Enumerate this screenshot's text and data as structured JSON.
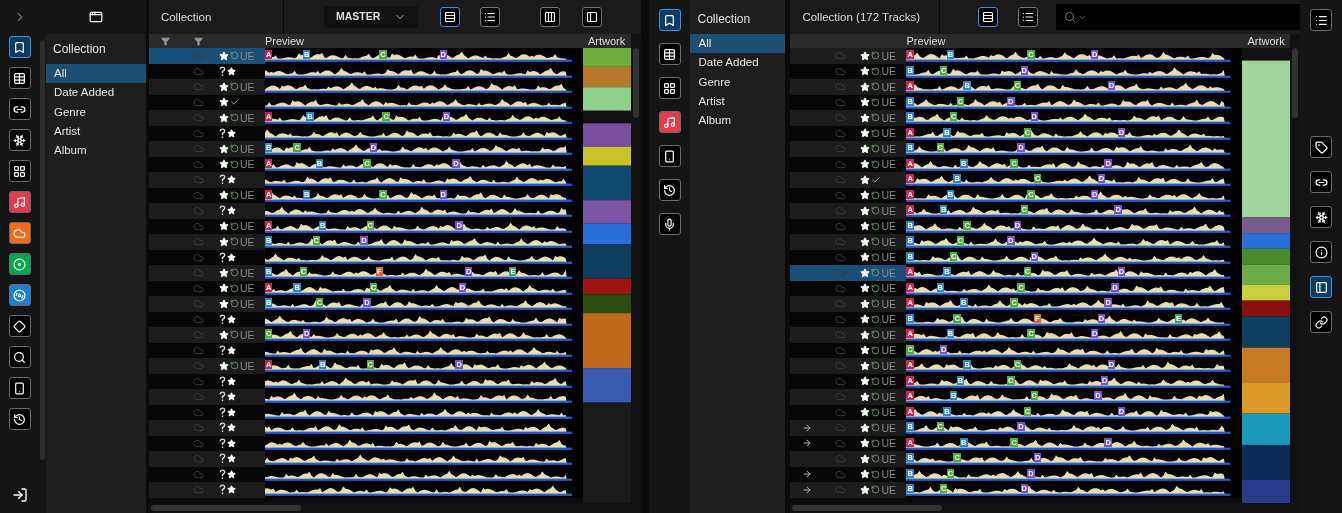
{
  "left_sidebar": {
    "icons": [
      {
        "kind": "bookmark",
        "selected": true
      },
      {
        "kind": "table",
        "selected": false
      },
      {
        "kind": "connector",
        "selected": false
      },
      {
        "kind": "burst",
        "selected": false
      },
      {
        "kind": "grid",
        "selected": false
      },
      {
        "kind": "music",
        "selected": false
      },
      {
        "kind": "soundcloud",
        "selected": false
      },
      {
        "kind": "beatport",
        "selected": false
      },
      {
        "kind": "beatsource",
        "selected": false
      },
      {
        "kind": "tidal",
        "selected": false
      },
      {
        "kind": "search",
        "selected": false
      },
      {
        "kind": "device",
        "selected": false
      },
      {
        "kind": "history",
        "selected": false
      }
    ]
  },
  "left_tree": {
    "title": "Collection",
    "items": [
      {
        "label": "All",
        "selected": true
      },
      {
        "label": "Date Added",
        "selected": false
      },
      {
        "label": "Genre",
        "selected": false
      },
      {
        "label": "Artist",
        "selected": false
      },
      {
        "label": "Album",
        "selected": false
      }
    ]
  },
  "left_deck": {
    "title": "Collection",
    "deck": "MASTER",
    "view_buttons": [
      {
        "kind": "detail",
        "selected": true
      },
      {
        "kind": "list",
        "selected": false
      },
      {
        "kind": "columns",
        "selected": false
      },
      {
        "kind": "panel",
        "selected": false
      }
    ],
    "columns": [
      "Preview",
      "Artwork"
    ],
    "tracks": [
      {
        "kind": "analyzed",
        "status": "UE",
        "selected": true,
        "cues": [
          {
            "label": "A",
            "color": "#d3224f"
          },
          {
            "label": "B",
            "color": "#2d86c9"
          },
          {
            "label": "C",
            "color": "#4fae3a"
          },
          {
            "label": "D",
            "color": "#7a4fd6"
          }
        ]
      },
      {
        "kind": "unanalyzed",
        "selected": false
      },
      {
        "kind": "analyzed",
        "status": "UE",
        "selected": false
      },
      {
        "kind": "checked",
        "selected": false
      },
      {
        "kind": "analyzed",
        "status": "UE",
        "selected": false,
        "cues": [
          {
            "label": "A",
            "color": "#d3224f"
          },
          {
            "label": "B",
            "color": "#2d86c9"
          },
          {
            "label": "C",
            "color": "#4fae3a"
          },
          {
            "label": "D",
            "color": "#7a4fd6"
          }
        ]
      },
      {
        "kind": "unanalyzed",
        "selected": false
      },
      {
        "kind": "analyzed",
        "status": "UE",
        "selected": false,
        "cues": [
          {
            "label": "B",
            "color": "#2d86c9"
          },
          {
            "label": "C",
            "color": "#4fae3a"
          },
          {
            "label": "D",
            "color": "#7a4fd6"
          }
        ]
      },
      {
        "kind": "analyzed",
        "status": "UE",
        "selected": false,
        "cues": [
          {
            "label": "A",
            "color": "#d3224f"
          },
          {
            "label": "B",
            "color": "#2d86c9"
          },
          {
            "label": "C",
            "color": "#4fae3a"
          },
          {
            "label": "D",
            "color": "#7a4fd6"
          }
        ]
      },
      {
        "kind": "unanalyzed",
        "selected": false
      },
      {
        "kind": "analyzed",
        "status": "UE",
        "selected": false,
        "cues": [
          {
            "label": "A",
            "color": "#d3224f"
          },
          {
            "label": "B",
            "color": "#2d86c9"
          },
          {
            "label": "C",
            "color": "#4fae3a"
          },
          {
            "label": "D",
            "color": "#7a4fd6"
          }
        ]
      },
      {
        "kind": "unanalyzed",
        "selected": false
      },
      {
        "kind": "analyzed",
        "status": "UE",
        "selected": false,
        "cues": [
          {
            "label": "A",
            "color": "#d3224f"
          },
          {
            "label": "B",
            "color": "#2d86c9"
          },
          {
            "label": "C",
            "color": "#4fae3a"
          },
          {
            "label": "D",
            "color": "#7a4fd6"
          }
        ]
      },
      {
        "kind": "analyzed",
        "status": "UE",
        "selected": false,
        "cues": [
          {
            "label": "B",
            "color": "#2d86c9"
          },
          {
            "label": "C",
            "color": "#4fae3a"
          },
          {
            "label": "D",
            "color": "#7a4fd6"
          }
        ]
      },
      {
        "kind": "unanalyzed",
        "selected": false
      },
      {
        "kind": "analyzed",
        "status": "UE",
        "selected": false,
        "cues": [
          {
            "label": "B",
            "color": "#2d86c9"
          },
          {
            "label": "C",
            "color": "#4fae3a"
          },
          {
            "label": "F",
            "color": "#e0652b"
          },
          {
            "label": "D",
            "color": "#7a4fd6"
          },
          {
            "label": "E",
            "color": "#38a86b"
          }
        ]
      },
      {
        "kind": "analyzed",
        "status": "UE",
        "selected": false,
        "cues": [
          {
            "label": "A",
            "color": "#d3224f"
          },
          {
            "label": "B",
            "color": "#2d86c9"
          },
          {
            "label": "C",
            "color": "#4fae3a"
          },
          {
            "label": "D",
            "color": "#7a4fd6"
          }
        ]
      },
      {
        "kind": "analyzed",
        "status": "UE",
        "selected": false,
        "cues": [
          {
            "label": "B",
            "color": "#2d86c9"
          },
          {
            "label": "C",
            "color": "#4fae3a"
          },
          {
            "label": "D",
            "color": "#7a4fd6"
          }
        ]
      },
      {
        "kind": "unanalyzed",
        "selected": false
      },
      {
        "kind": "analyzed",
        "status": "UE",
        "selected": false,
        "cues": [
          {
            "label": "C",
            "color": "#4fae3a"
          },
          {
            "label": "D",
            "color": "#7a4fd6"
          }
        ]
      },
      {
        "kind": "unanalyzed",
        "selected": false
      },
      {
        "kind": "analyzed",
        "status": "UE",
        "selected": false,
        "cues": [
          {
            "label": "A",
            "color": "#d3224f"
          },
          {
            "label": "B",
            "color": "#2d86c9"
          },
          {
            "label": "C",
            "color": "#4fae3a"
          },
          {
            "label": "D",
            "color": "#7a4fd6"
          }
        ]
      },
      {
        "kind": "unanalyzed",
        "selected": false
      },
      {
        "kind": "unanalyzed",
        "selected": false
      },
      {
        "kind": "unanalyzed",
        "selected": false
      },
      {
        "kind": "unanalyzed",
        "selected": false
      },
      {
        "kind": "unanalyzed",
        "selected": false
      },
      {
        "kind": "unanalyzed",
        "selected": false
      },
      {
        "kind": "unanalyzed",
        "selected": false
      },
      {
        "kind": "unanalyzed",
        "selected": false
      }
    ]
  },
  "middle_sidebar": {
    "icons": [
      {
        "kind": "bookmark",
        "selected": true
      },
      {
        "kind": "table",
        "selected": false
      },
      {
        "kind": "grid",
        "selected": false
      },
      {
        "kind": "music",
        "selected": false
      },
      {
        "kind": "device",
        "selected": false
      },
      {
        "kind": "history",
        "selected": false
      },
      {
        "kind": "mic",
        "selected": false
      }
    ]
  },
  "right_tree": {
    "title": "Collection",
    "items": [
      {
        "label": "All",
        "selected": true
      },
      {
        "label": "Date Added",
        "selected": false
      },
      {
        "label": "Genre",
        "selected": false
      },
      {
        "label": "Artist",
        "selected": false
      },
      {
        "label": "Album",
        "selected": false
      }
    ]
  },
  "right_deck": {
    "title": "Collection (172 Tracks)",
    "view_buttons": [
      {
        "kind": "detail",
        "selected": true
      },
      {
        "kind": "list",
        "selected": false
      }
    ],
    "columns": [
      "Preview",
      "Artwork"
    ],
    "tracks": [
      {
        "kind": "analyzed",
        "status": "UE",
        "selected": false,
        "arrow": false,
        "cues": [
          {
            "label": "A",
            "color": "#d3224f"
          },
          {
            "label": "B",
            "color": "#2d86c9"
          },
          {
            "label": "C",
            "color": "#4fae3a"
          },
          {
            "label": "D",
            "color": "#7a4fd6"
          }
        ]
      },
      {
        "kind": "analyzed",
        "status": "UE",
        "selected": false,
        "arrow": false,
        "cues": [
          {
            "label": "B",
            "color": "#2d86c9"
          },
          {
            "label": "C",
            "color": "#4fae3a"
          },
          {
            "label": "D",
            "color": "#7a4fd6"
          }
        ]
      },
      {
        "kind": "analyzed",
        "status": "UE",
        "selected": false,
        "arrow": false,
        "cues": [
          {
            "label": "A",
            "color": "#d3224f"
          },
          {
            "label": "B",
            "color": "#2d86c9"
          },
          {
            "label": "C",
            "color": "#4fae3a"
          },
          {
            "label": "D",
            "color": "#7a4fd6"
          }
        ]
      },
      {
        "kind": "analyzed",
        "status": "UE",
        "selected": false,
        "arrow": false,
        "cues": [
          {
            "label": "B",
            "color": "#2d86c9"
          },
          {
            "label": "C",
            "color": "#4fae3a"
          },
          {
            "label": "D",
            "color": "#7a4fd6"
          }
        ]
      },
      {
        "kind": "analyzed",
        "status": "UE",
        "selected": false,
        "arrow": false,
        "cues": [
          {
            "label": "B",
            "color": "#2d86c9"
          },
          {
            "label": "C",
            "color": "#4fae3a"
          },
          {
            "label": "D",
            "color": "#7a4fd6"
          }
        ]
      },
      {
        "kind": "analyzed",
        "status": "UE",
        "selected": false,
        "arrow": false,
        "cues": [
          {
            "label": "A",
            "color": "#d3224f"
          },
          {
            "label": "B",
            "color": "#2d86c9"
          },
          {
            "label": "C",
            "color": "#4fae3a"
          },
          {
            "label": "D",
            "color": "#7a4fd6"
          }
        ]
      },
      {
        "kind": "analyzed",
        "status": "UE",
        "selected": false,
        "arrow": false,
        "cues": [
          {
            "label": "B",
            "color": "#2d86c9"
          },
          {
            "label": "C",
            "color": "#4fae3a"
          },
          {
            "label": "D",
            "color": "#7a4fd6"
          }
        ]
      },
      {
        "kind": "analyzed",
        "status": "UE",
        "selected": false,
        "arrow": false,
        "cues": [
          {
            "label": "A",
            "color": "#d3224f"
          },
          {
            "label": "B",
            "color": "#2d86c9"
          },
          {
            "label": "C",
            "color": "#4fae3a"
          },
          {
            "label": "D",
            "color": "#7a4fd6"
          }
        ]
      },
      {
        "kind": "checked",
        "selected": false,
        "arrow": false,
        "cues": [
          {
            "label": "A",
            "color": "#d3224f"
          },
          {
            "label": "B",
            "color": "#2d86c9"
          },
          {
            "label": "C",
            "color": "#4fae3a"
          },
          {
            "label": "D",
            "color": "#7a4fd6"
          }
        ]
      },
      {
        "kind": "analyzed",
        "status": "UE",
        "selected": false,
        "arrow": false,
        "cues": [
          {
            "label": "A",
            "color": "#d3224f"
          },
          {
            "label": "B",
            "color": "#2d86c9"
          },
          {
            "label": "C",
            "color": "#4fae3a"
          },
          {
            "label": "D",
            "color": "#7a4fd6"
          }
        ]
      },
      {
        "kind": "analyzed",
        "status": "UE",
        "selected": false,
        "arrow": false,
        "cues": [
          {
            "label": "A",
            "color": "#d3224f"
          },
          {
            "label": "B",
            "color": "#2d86c9"
          },
          {
            "label": "C",
            "color": "#4fae3a"
          },
          {
            "label": "D",
            "color": "#7a4fd6"
          }
        ]
      },
      {
        "kind": "analyzed",
        "status": "UE",
        "selected": false,
        "arrow": false,
        "cues": [
          {
            "label": "B",
            "color": "#2d86c9"
          },
          {
            "label": "C",
            "color": "#4fae3a"
          },
          {
            "label": "D",
            "color": "#7a4fd6"
          }
        ]
      },
      {
        "kind": "analyzed",
        "status": "UE",
        "selected": false,
        "arrow": false,
        "cues": [
          {
            "label": "B",
            "color": "#2d86c9"
          },
          {
            "label": "C",
            "color": "#4fae3a"
          },
          {
            "label": "D",
            "color": "#7a4fd6"
          }
        ]
      },
      {
        "kind": "analyzed",
        "status": "UE",
        "selected": false,
        "arrow": false,
        "cues": [
          {
            "label": "B",
            "color": "#2d86c9"
          },
          {
            "label": "C",
            "color": "#4fae3a"
          },
          {
            "label": "D",
            "color": "#7a4fd6"
          }
        ]
      },
      {
        "kind": "analyzed",
        "status": "UE",
        "selected": true,
        "arrow": false,
        "cues": [
          {
            "label": "A",
            "color": "#d3224f"
          },
          {
            "label": "B",
            "color": "#2d86c9"
          },
          {
            "label": "C",
            "color": "#4fae3a"
          },
          {
            "label": "D",
            "color": "#7a4fd6"
          }
        ]
      },
      {
        "kind": "analyzed",
        "status": "UE",
        "selected": false,
        "arrow": false,
        "cues": [
          {
            "label": "A",
            "color": "#d3224f"
          },
          {
            "label": "B",
            "color": "#2d86c9"
          },
          {
            "label": "C",
            "color": "#4fae3a"
          },
          {
            "label": "D",
            "color": "#7a4fd6"
          }
        ]
      },
      {
        "kind": "analyzed",
        "status": "UE",
        "selected": false,
        "arrow": false,
        "cues": [
          {
            "label": "A",
            "color": "#d3224f"
          },
          {
            "label": "B",
            "color": "#2d86c9"
          },
          {
            "label": "C",
            "color": "#4fae3a"
          },
          {
            "label": "D",
            "color": "#7a4fd6"
          }
        ]
      },
      {
        "kind": "analyzed",
        "status": "UE",
        "selected": false,
        "arrow": false,
        "cues": [
          {
            "label": "B",
            "color": "#2d86c9"
          },
          {
            "label": "C",
            "color": "#4fae3a"
          },
          {
            "label": "F",
            "color": "#e0652b"
          },
          {
            "label": "D",
            "color": "#7a4fd6"
          },
          {
            "label": "E",
            "color": "#38a86b"
          }
        ]
      },
      {
        "kind": "analyzed",
        "status": "UE",
        "selected": false,
        "arrow": false,
        "cues": [
          {
            "label": "A",
            "color": "#d3224f"
          },
          {
            "label": "B",
            "color": "#2d86c9"
          },
          {
            "label": "C",
            "color": "#4fae3a"
          },
          {
            "label": "D",
            "color": "#7a4fd6"
          }
        ]
      },
      {
        "kind": "analyzed",
        "status": "UE",
        "selected": false,
        "arrow": false,
        "cues": [
          {
            "label": "C",
            "color": "#4fae3a"
          },
          {
            "label": "D",
            "color": "#7a4fd6"
          }
        ]
      },
      {
        "kind": "analyzed",
        "status": "UE",
        "selected": false,
        "arrow": false,
        "cues": [
          {
            "label": "A",
            "color": "#d3224f"
          },
          {
            "label": "B",
            "color": "#2d86c9"
          },
          {
            "label": "C",
            "color": "#4fae3a"
          },
          {
            "label": "D",
            "color": "#7a4fd6"
          }
        ]
      },
      {
        "kind": "analyzed",
        "status": "UE",
        "selected": false,
        "arrow": false,
        "cues": [
          {
            "label": "A",
            "color": "#d3224f"
          },
          {
            "label": "B",
            "color": "#2d86c9"
          },
          {
            "label": "C",
            "color": "#4fae3a"
          },
          {
            "label": "D",
            "color": "#7a4fd6"
          }
        ]
      },
      {
        "kind": "analyzed",
        "status": "UE",
        "selected": false,
        "arrow": false,
        "cues": [
          {
            "label": "A",
            "color": "#d3224f"
          },
          {
            "label": "B",
            "color": "#2d86c9"
          },
          {
            "label": "C",
            "color": "#4fae3a"
          },
          {
            "label": "D",
            "color": "#7a4fd6"
          }
        ]
      },
      {
        "kind": "analyzed",
        "status": "UE",
        "selected": false,
        "arrow": false,
        "cues": [
          {
            "label": "A",
            "color": "#d3224f"
          },
          {
            "label": "B",
            "color": "#2d86c9"
          },
          {
            "label": "C",
            "color": "#4fae3a"
          },
          {
            "label": "D",
            "color": "#7a4fd6"
          }
        ]
      },
      {
        "kind": "analyzed",
        "status": "UE",
        "selected": false,
        "arrow": true,
        "cues": [
          {
            "label": "B",
            "color": "#2d86c9"
          },
          {
            "label": "C",
            "color": "#4fae3a"
          },
          {
            "label": "D",
            "color": "#7a4fd6"
          }
        ]
      },
      {
        "kind": "analyzed",
        "status": "UE",
        "selected": false,
        "arrow": true,
        "cues": [
          {
            "label": "A",
            "color": "#d3224f"
          },
          {
            "label": "B",
            "color": "#2d86c9"
          },
          {
            "label": "C",
            "color": "#4fae3a"
          },
          {
            "label": "D",
            "color": "#7a4fd6"
          }
        ]
      },
      {
        "kind": "analyzed",
        "status": "UE",
        "selected": false,
        "arrow": false,
        "cues": [
          {
            "label": "B",
            "color": "#2d86c9"
          },
          {
            "label": "C",
            "color": "#4fae3a"
          },
          {
            "label": "D",
            "color": "#7a4fd6"
          }
        ]
      },
      {
        "kind": "analyzed",
        "status": "UE",
        "selected": false,
        "arrow": true,
        "cues": [
          {
            "label": "B",
            "color": "#2d86c9"
          },
          {
            "label": "C",
            "color": "#4fae3a"
          },
          {
            "label": "D",
            "color": "#7a4fd6"
          }
        ]
      },
      {
        "kind": "analyzed",
        "status": "UE",
        "selected": false,
        "arrow": true,
        "cues": [
          {
            "label": "B",
            "color": "#2d86c9"
          },
          {
            "label": "C",
            "color": "#4fae3a"
          },
          {
            "label": "D",
            "color": "#7a4fd6"
          }
        ]
      }
    ]
  },
  "right_sidebar": {
    "icons": [
      {
        "kind": "menu",
        "selected": false
      },
      {
        "kind": "tag",
        "selected": false
      },
      {
        "kind": "connector",
        "selected": false
      },
      {
        "kind": "burst",
        "selected": false
      },
      {
        "kind": "info",
        "selected": false
      },
      {
        "kind": "panel",
        "selected": true
      },
      {
        "kind": "chain",
        "selected": false
      }
    ]
  }
}
